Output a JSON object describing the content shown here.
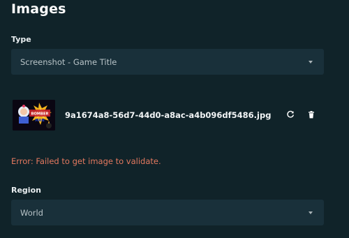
{
  "heading": "Images",
  "type_field": {
    "label": "Type",
    "value": "Screenshot - Game Title"
  },
  "image": {
    "filename": "9a1674a8-56d7-44d0-a8ac-a4b096df5486.jpg",
    "thumbnail_logo_text": "BOMBER MAN",
    "actions": {
      "refresh_icon": "refresh-icon",
      "delete_icon": "trash-icon"
    }
  },
  "error_message": "Error: Failed to get image to validate.",
  "region_field": {
    "label": "Region",
    "value": "World"
  },
  "colors": {
    "background": "#102329",
    "field_background": "#19303a",
    "error": "#e4795f"
  }
}
